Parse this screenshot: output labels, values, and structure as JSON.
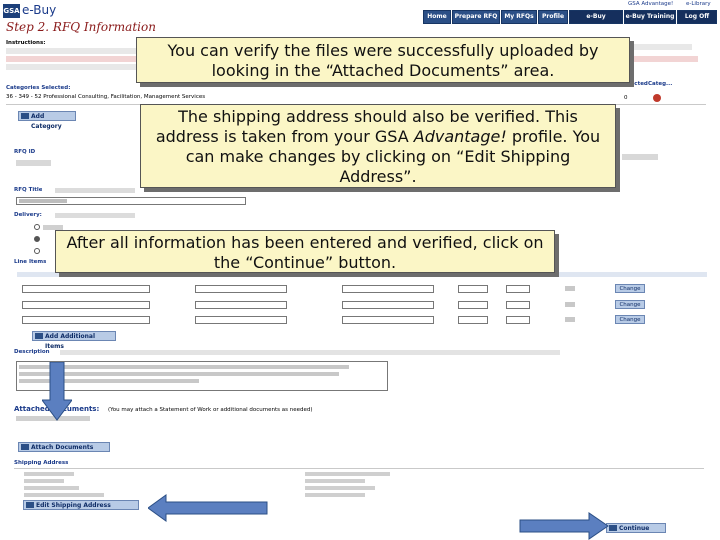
{
  "header": {
    "logo": "GSA",
    "app_name": "e-Buy",
    "page_heading": "Step 2. RFQ Information",
    "top_links": [
      "GSA Advantage!",
      "e-Library"
    ],
    "nav": [
      "Home",
      "Prepare RFQ",
      "My RFQs",
      "Profile",
      "e-Buy Guidance",
      "e-Buy Training",
      "Log Off"
    ]
  },
  "form": {
    "instructions_label": "Instructions:",
    "categories_label": "Categories Selected:",
    "category_row": "36 - 349 - 52 Professional Consulting, Facilitation, Management Services",
    "add_category": "Add Category",
    "rfq_id_label": "RFQ ID",
    "rfq_title_label": "RFQ Title",
    "delivery_label": "Delivery:",
    "line_items_label": "Line Items",
    "add_items": "Add Additional Items",
    "description_label": "Description",
    "attached_docs_label": "Attached Documents:",
    "attached_docs_note": "(You may attach a Statement of Work or additional documents as needed)",
    "attach_button": "Attach Documents",
    "shipping_label": "Shipping Address",
    "edit_shipping": "Edit Shipping Address",
    "continue": "Continue",
    "change": "Change",
    "right_header": [
      "Selected",
      "Categ..."
    ],
    "right_count": "0"
  },
  "callouts": {
    "c1": "You can verify the files were successfully uploaded by looking in the “Attached Documents” area.",
    "c2_a": "The shipping address should also be verified.  This address is taken from your GSA ",
    "c2_em": "Advantage!",
    "c2_b": " profile.  You can make changes by clicking on “Edit Shipping Address”.",
    "c3": "After all information has been entered and verified, click on the “Continue” button."
  },
  "colors": {
    "nav_blue": "#2b4f86",
    "callout_bg": "#fbf6c6",
    "arrow_blue": "#5b7fc0"
  }
}
